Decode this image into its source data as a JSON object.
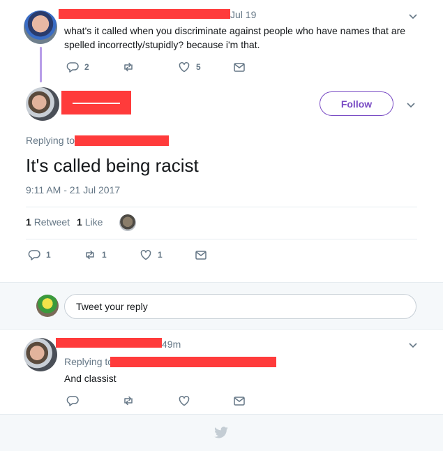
{
  "tweet1": {
    "date": "Jul 19",
    "text": "what's it called when you discriminate against people who have names that are spelled incorrectly/stupidly? because i'm that.",
    "reply_count": "2",
    "retweet_count": "",
    "like_count": "5"
  },
  "main_tweet": {
    "follow_label": "Follow",
    "replying_to_prefix": "Replying to",
    "text": "It's called being racist",
    "timestamp": "9:11 AM - 21 Jul 2017",
    "stats": {
      "retweets_count": "1",
      "retweets_label": "Retweet",
      "likes_count": "1",
      "likes_label": "Like"
    },
    "reply_count": "1",
    "retweet_count": "1",
    "like_count": "1"
  },
  "reply_box": {
    "placeholder": "Tweet your reply"
  },
  "tweet3": {
    "time": "49m",
    "replying_to_prefix": "Replying to",
    "text": "And classist"
  },
  "colors": {
    "accent": "#794bc4",
    "redaction": "#ff3b3b",
    "thread_line": "#b79de8",
    "muted": "#657786"
  },
  "icons": [
    "reply-icon",
    "retweet-icon",
    "like-icon",
    "message-icon",
    "chevron-down-icon",
    "twitter-bird-icon"
  ]
}
